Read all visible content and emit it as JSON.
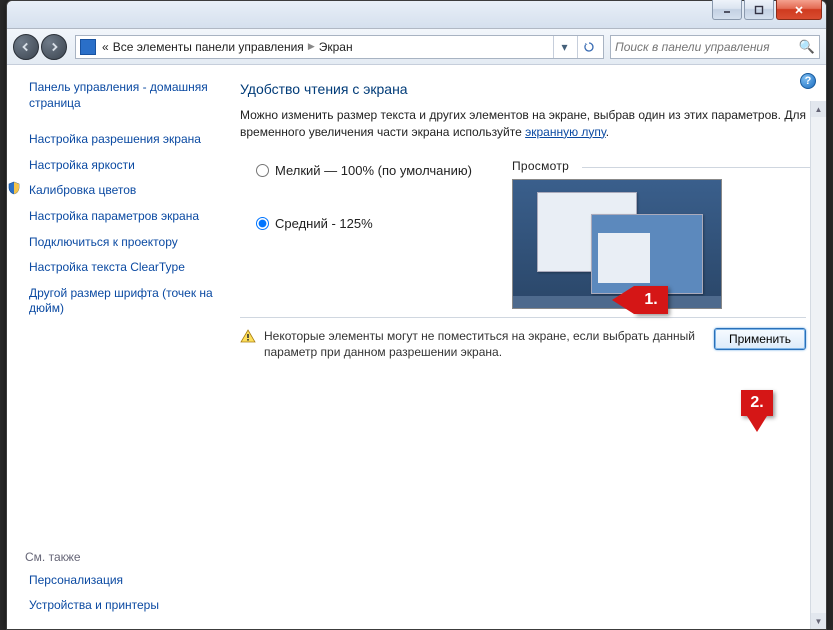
{
  "titlebar": {
    "min": "—",
    "max": "▣",
    "close": "✕"
  },
  "toolbar": {
    "bread1_prefix": "«",
    "bread1": "Все элементы панели управления",
    "bread2": "Экран",
    "search_placeholder": "Поиск в панели управления"
  },
  "sidebar": {
    "home": "Панель управления - домашняя страница",
    "links": [
      "Настройка разрешения экрана",
      "Настройка яркости",
      "Калибровка цветов",
      "Настройка параметров экрана",
      "Подключиться к проектору",
      "Настройка текста ClearType",
      "Другой размер шрифта (точек на дюйм)"
    ],
    "footer_head": "См. также",
    "footer_links": [
      "Персонализация",
      "Устройства и принтеры"
    ]
  },
  "main": {
    "title": "Удобство чтения с экрана",
    "intro_a": "Можно изменить размер текста и других элементов на экране, выбрав один из этих параметров. Для временного увеличения части экрана используйте ",
    "intro_link": "экранную лупу",
    "intro_b": ".",
    "radio1": "Мелкий — 100% (по умолчанию)",
    "radio2": "Средний - 125%",
    "preview_label": "Просмотр",
    "warn": "Некоторые элементы могут не поместиться на экране, если выбрать данный параметр при данном разрешении экрана.",
    "apply": "Применить"
  },
  "callout": {
    "c1": "1.",
    "c2": "2."
  },
  "help": "?"
}
